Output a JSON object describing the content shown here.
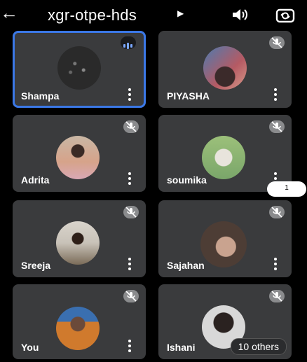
{
  "header": {
    "back_icon": "arrow-left-icon",
    "meeting_code": "xgr-otpe-hds",
    "caret_icon": "caret-right-icon",
    "speaker_icon": "speaker-icon",
    "flip_camera_icon": "flip-camera-icon"
  },
  "participants": [
    {
      "name": "Shampa",
      "active_speaker": true,
      "muted": false,
      "avatar_color": "#2a2a2a"
    },
    {
      "name": "PIYASHA",
      "muted": true,
      "avatar_color": "#b55a63"
    },
    {
      "name": "Adrita",
      "muted": true,
      "avatar_color": "#d6a38a"
    },
    {
      "name": "soumika",
      "muted": true,
      "avatar_color": "#7aa66a"
    },
    {
      "name": "Sreeja",
      "muted": true,
      "avatar_color": "#c8c2b8"
    },
    {
      "name": "Sajahan",
      "muted": true,
      "avatar_color": "#4d3d35"
    },
    {
      "name": "You",
      "muted": true,
      "avatar_color": "#d07a2d"
    },
    {
      "name": "Ishani",
      "muted": true,
      "avatar_color": "#d8d8d8"
    }
  ],
  "others_pill": "10 others",
  "notification_badge": "1",
  "colors": {
    "active_border": "#3b78e7",
    "tile_bg": "#3a3b3d"
  }
}
